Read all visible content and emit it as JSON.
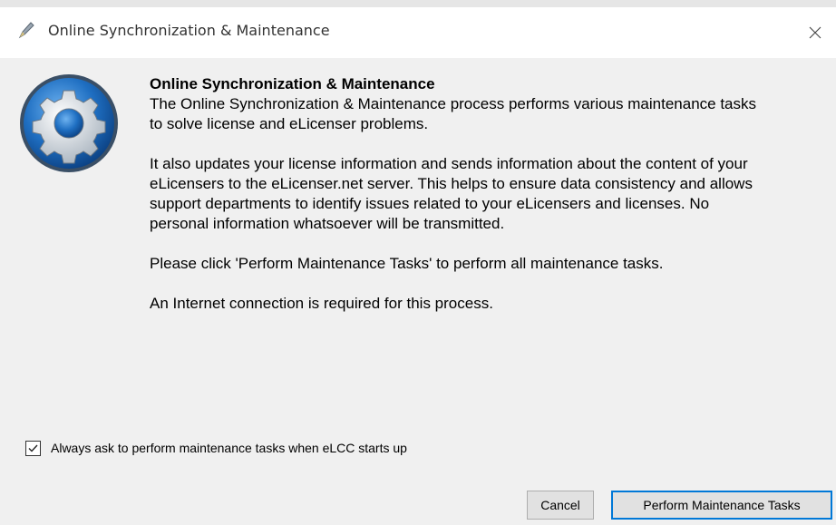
{
  "window": {
    "title": "Online Synchronization & Maintenance",
    "close_glyph": "✕"
  },
  "content": {
    "heading": "Online Synchronization & Maintenance",
    "paragraphs": [
      "The Online Synchronization & Maintenance process performs various maintenance tasks to solve license and eLicenser problems.",
      "It also updates your license information and sends information about the content of your eLicensers to the eLicenser.net server. This helps to ensure data consistency and allows support departments to identify issues related to your eLicensers and licenses. No personal information whatsoever will be transmitted.",
      "Please click 'Perform Maintenance Tasks' to perform all maintenance tasks.",
      "An Internet connection is required for this process."
    ]
  },
  "options": {
    "always_ask_label": "Always ask to perform maintenance tasks when eLCC starts up",
    "always_ask_checked": true
  },
  "buttons": {
    "cancel": "Cancel",
    "perform": "Perform Maintenance Tasks"
  },
  "icons": {
    "title_icon": "pen-icon",
    "main_icon": "gear-icon",
    "close_icon": "close-icon"
  },
  "colors": {
    "dialog_bg": "#f0f0f0",
    "accent": "#0078d7",
    "gear_blue": "#1f6fc2"
  }
}
